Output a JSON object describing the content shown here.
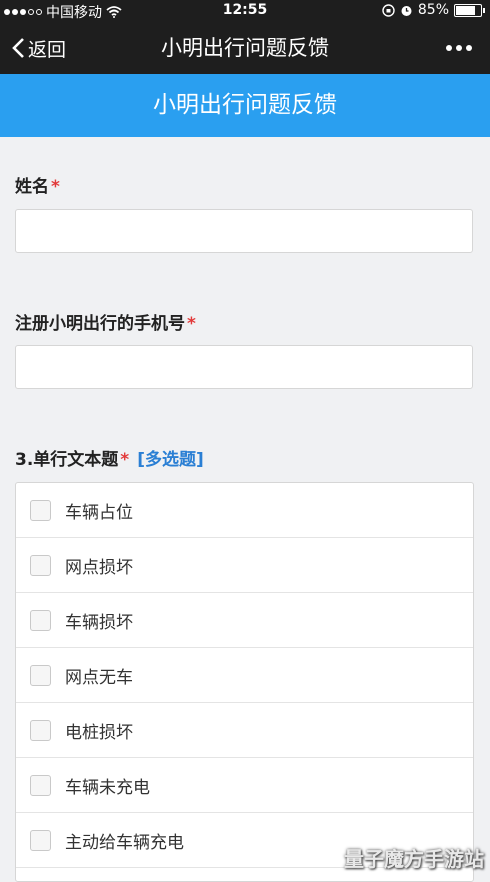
{
  "status": {
    "carrier": "中国移动",
    "time": "12:55",
    "battery": "85%",
    "battery_level": 0.85
  },
  "nav": {
    "back_label": "返回",
    "title": "小明出行问题反馈"
  },
  "banner": {
    "title": "小明出行问题反馈"
  },
  "questions": [
    {
      "label": "姓名",
      "required": "*"
    },
    {
      "label": "注册小明出行的手机号",
      "required": "*"
    },
    {
      "label": "3.单行文本题",
      "required": "*",
      "type_tag": "[多选题]",
      "options": [
        "车辆占位",
        "网点损坏",
        "车辆损坏",
        "网点无车",
        "电桩损坏",
        "车辆未充电",
        "主动给车辆充电"
      ]
    }
  ],
  "watermark": "量子魔方手游站",
  "colors": {
    "banner": "#2a9ff0",
    "required": "#e23a3a",
    "tag": "#2a7fd4",
    "bar": "#1e1e1e"
  }
}
